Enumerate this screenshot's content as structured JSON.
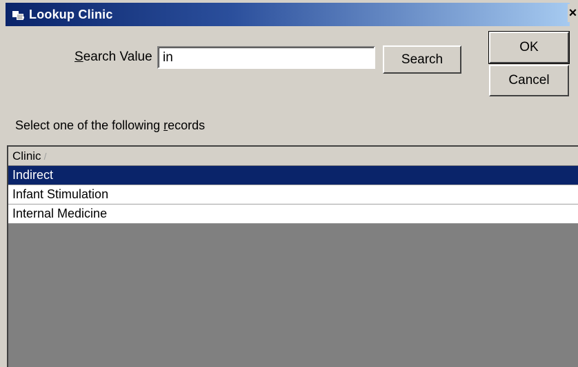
{
  "window": {
    "title": "Lookup Clinic",
    "close_glyph": "×"
  },
  "search": {
    "label_prefix": "S",
    "label_rest": "earch Value",
    "value": "in",
    "button_label": "Search"
  },
  "dialog_buttons": {
    "ok_label": "OK",
    "cancel_label": "Cancel"
  },
  "instruction": {
    "prefix": "Select one of the following ",
    "accel": "r",
    "rest": "ecords"
  },
  "grid": {
    "column_header": "Clinic",
    "sort_indicator": "/",
    "rows": [
      {
        "label": "Indirect",
        "selected": true
      },
      {
        "label": "Infant Stimulation",
        "selected": false
      },
      {
        "label": "Internal Medicine",
        "selected": false
      }
    ]
  },
  "colors": {
    "selection": "#0a246a",
    "face": "#d4d0c8",
    "empty_grid": "#808080"
  }
}
